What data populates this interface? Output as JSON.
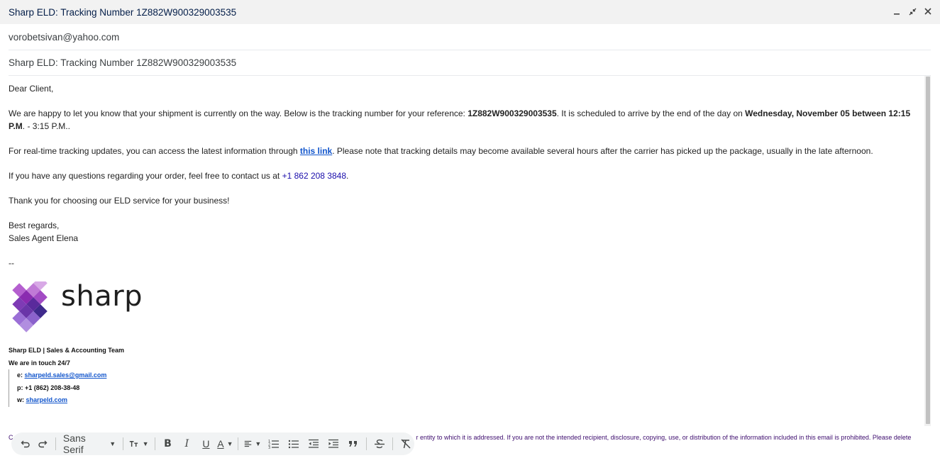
{
  "window": {
    "title": "Sharp ELD: Tracking Number 1Z882W900329003535",
    "minimize_icon": "minimize-icon",
    "expand_icon": "exit-fullscreen-icon",
    "close_icon": "close-icon"
  },
  "to": {
    "value": "vorobetsivan@yahoo.com"
  },
  "subject": {
    "value": "Sharp ELD: Tracking Number 1Z882W900329003535"
  },
  "body": {
    "greeting": "Dear Client,",
    "p1_a": "We are happy to let you know that your shipment is currently on the way. Below is the tracking number for your reference: ",
    "p1_tracking": "1Z882W900329003535",
    "p1_b": ". It is scheduled to arrive by the end of the day on ",
    "p1_date": "Wednesday, November 05 between 12:15 P.M",
    "p1_c": ". - 3:15 P.M..",
    "p2_a": "For real-time tracking updates, you can access the latest information through ",
    "p2_link": "this link",
    "p2_b": ". Please note that tracking details may become available several hours after the carrier has picked up the package, usually in the late afternoon.",
    "p3_a": "If you have any questions regarding your order, feel free to contact us at ",
    "p3_phone": "+1 862 208 3848",
    "p3_b": ".",
    "p4": "Thank you for choosing our ELD service for your business!",
    "closing1": "Best regards,",
    "closing2": "Sales Agent Elena",
    "dashes": "--"
  },
  "signature": {
    "logo_text": "sharp",
    "team": "Sharp ELD | Sales & Accounting Team",
    "touch": "We are in touch 24/7",
    "email_prefix": "e: ",
    "email": "sharpeld.sales@gmail.com",
    "phone": "p: +1 (862) 208-38-48",
    "web_prefix": "w: ",
    "web": "sharpeld.com",
    "logo_colors": [
      "#cf9be0",
      "#b45fcf",
      "#8a2bb0",
      "#5a2a9c",
      "#3f2a8c",
      "#9b6fd6"
    ]
  },
  "disclaimer": {
    "visible_start": "C",
    "text": "r entity to which it is addressed. If you are not the intended recipient, disclosure, copying, use, or distribution of the information included in this email is prohibited. Please delete"
  },
  "toolbar": {
    "undo_icon": "undo-icon",
    "redo_icon": "redo-icon",
    "font": "Sans Serif",
    "size_icon": "text-size-icon",
    "bold": "B",
    "italic": "I",
    "underline": "U",
    "text_color": "A",
    "align_icon": "align-icon",
    "numbered_icon": "numbered-list-icon",
    "bulleted_icon": "bulleted-list-icon",
    "indent_less_icon": "indent-less-icon",
    "indent_more_icon": "indent-more-icon",
    "quote_icon": "quote-icon",
    "strike_icon": "strikethrough-icon",
    "clear_format_icon": "clear-formatting-icon"
  }
}
